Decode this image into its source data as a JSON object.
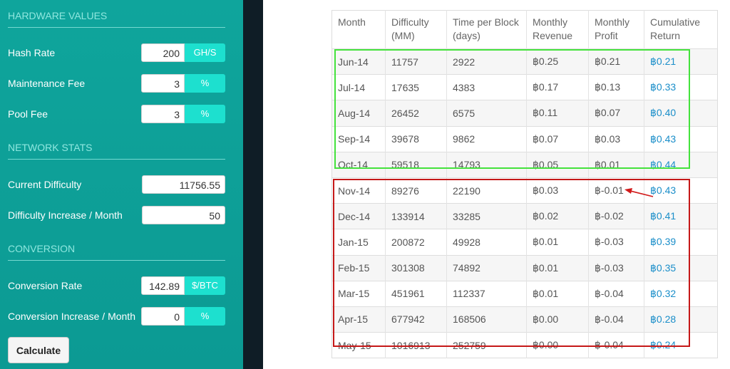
{
  "sidebar": {
    "hardware_title": "HARDWARE VALUES",
    "hash_rate_label": "Hash Rate",
    "hash_rate_value": "200",
    "hash_rate_unit": "GH/S",
    "maintenance_label": "Maintenance Fee",
    "maintenance_value": "3",
    "maintenance_unit": "%",
    "pool_label": "Pool Fee",
    "pool_value": "3",
    "pool_unit": "%",
    "network_title": "NETWORK STATS",
    "difficulty_label": "Current Difficulty",
    "difficulty_value": "11756.55",
    "diff_increase_label": "Difficulty Increase / Month",
    "diff_increase_value": "50",
    "conversion_title": "CONVERSION",
    "conv_rate_label": "Conversion Rate",
    "conv_rate_value": "142.89",
    "conv_rate_unit": "$/BTC",
    "conv_increase_label": "Conversion Increase / Month",
    "conv_increase_value": "0",
    "conv_increase_unit": "%",
    "calculate_label": "Calculate"
  },
  "table": {
    "headers": [
      "Month",
      "Difficulty (MM)",
      "Time per Block (days)",
      "Monthly Revenue",
      "Monthly Profit",
      "Cumulative Return"
    ],
    "rows": [
      [
        "Jun-14",
        "11757",
        "2922",
        "฿0.25",
        "฿0.21",
        "฿0.21"
      ],
      [
        "Jul-14",
        "17635",
        "4383",
        "฿0.17",
        "฿0.13",
        "฿0.33"
      ],
      [
        "Aug-14",
        "26452",
        "6575",
        "฿0.11",
        "฿0.07",
        "฿0.40"
      ],
      [
        "Sep-14",
        "39678",
        "9862",
        "฿0.07",
        "฿0.03",
        "฿0.43"
      ],
      [
        "Oct-14",
        "59518",
        "14793",
        "฿0.05",
        "฿0.01",
        "฿0.44"
      ],
      [
        "Nov-14",
        "89276",
        "22190",
        "฿0.03",
        "฿-0.01",
        "฿0.43"
      ],
      [
        "Dec-14",
        "133914",
        "33285",
        "฿0.02",
        "฿-0.02",
        "฿0.41"
      ],
      [
        "Jan-15",
        "200872",
        "49928",
        "฿0.01",
        "฿-0.03",
        "฿0.39"
      ],
      [
        "Feb-15",
        "301308",
        "74892",
        "฿0.01",
        "฿-0.03",
        "฿0.35"
      ],
      [
        "Mar-15",
        "451961",
        "112337",
        "฿0.01",
        "฿-0.04",
        "฿0.32"
      ],
      [
        "Apr-15",
        "677942",
        "168506",
        "฿0.00",
        "฿-0.04",
        "฿0.28"
      ],
      [
        "May-15",
        "1016913",
        "252759",
        "฿0.00",
        "฿-0.04",
        "฿0.24"
      ]
    ]
  },
  "colors": {
    "sidebar": "#0fa59c",
    "addon": "#1de0cf",
    "highlight_positive": "#44e23c",
    "highlight_negative": "#c51818",
    "cumulative_text": "#1a8ec9"
  }
}
